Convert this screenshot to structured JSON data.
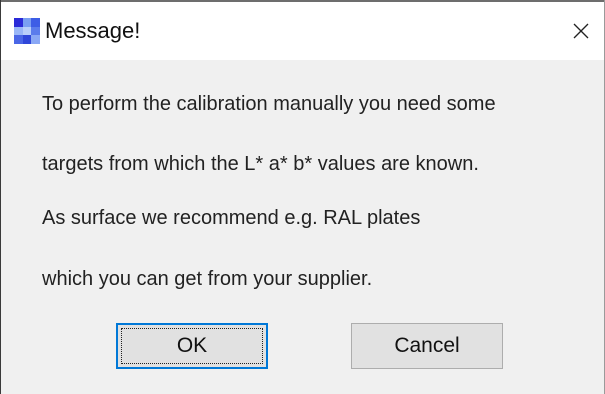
{
  "window": {
    "title": "Message!",
    "icon": "app-gradient-icon",
    "close_glyph": "✕"
  },
  "message": {
    "lines": [
      "To perform the calibration manually you need some",
      "targets from which the L* a* b* values are known.",
      "As surface we recommend e.g. RAL plates",
      "which you can get from your supplier."
    ]
  },
  "buttons": {
    "ok_label": "OK",
    "cancel_label": "Cancel"
  },
  "colors": {
    "focus_border": "#0078d7",
    "button_face": "#e1e1e1",
    "dialog_background": "#f0f0f0",
    "titlebar_background": "#ffffff"
  }
}
